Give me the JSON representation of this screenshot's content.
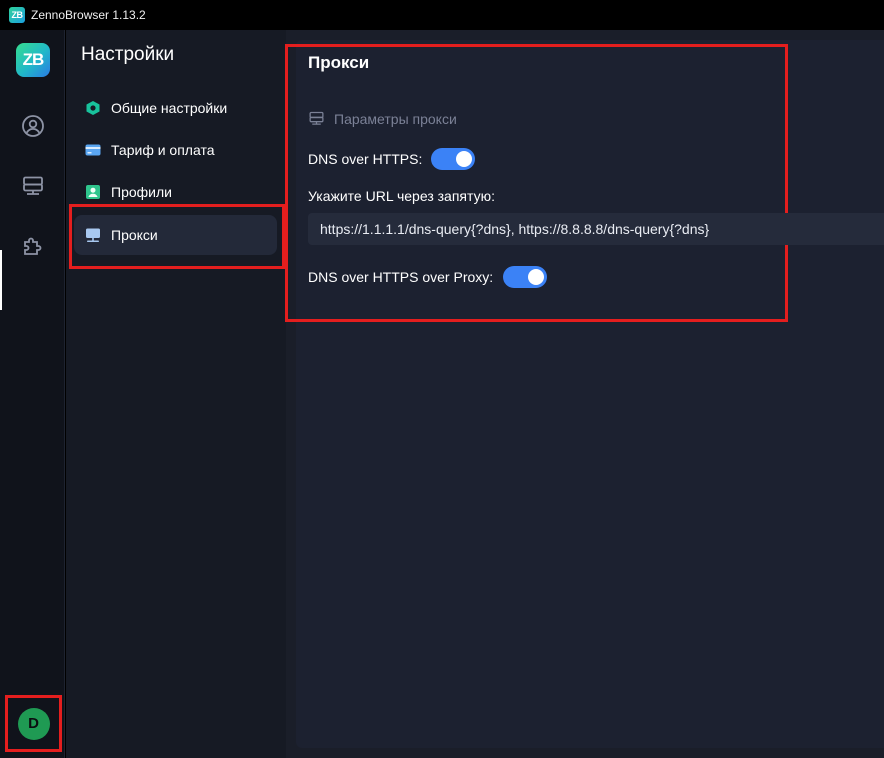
{
  "window": {
    "title": "ZennoBrowser 1.13.2",
    "logo_text": "ZB"
  },
  "rail": {
    "logo_text": "ZB",
    "icons": [
      "user-circle-icon",
      "server-icon",
      "puzzle-icon"
    ],
    "user_initial": "D"
  },
  "nav": {
    "title": "Настройки",
    "items": [
      {
        "label": "Общие настройки",
        "icon": "settings-hex-icon"
      },
      {
        "label": "Тариф и оплата",
        "icon": "credit-card-icon"
      },
      {
        "label": "Профили",
        "icon": "profile-card-icon"
      },
      {
        "label": "Прокси",
        "icon": "monitor-network-icon",
        "active": true
      }
    ]
  },
  "proxy": {
    "title": "Прокси",
    "subheading": "Параметры прокси",
    "doh_label": "DNS over HTTPS:",
    "doh_enabled": true,
    "url_label": "Укажите URL через запятую:",
    "url_value": "https://1.1.1.1/dns-query{?dns}, https://8.8.8.8/dns-query{?dns}",
    "doh_proxy_label": "DNS over HTTPS over Proxy:",
    "doh_proxy_enabled": true
  },
  "colors": {
    "accent": "#3b82f6",
    "highlight": "#e41e1e",
    "avatar": "#1f9a53"
  }
}
